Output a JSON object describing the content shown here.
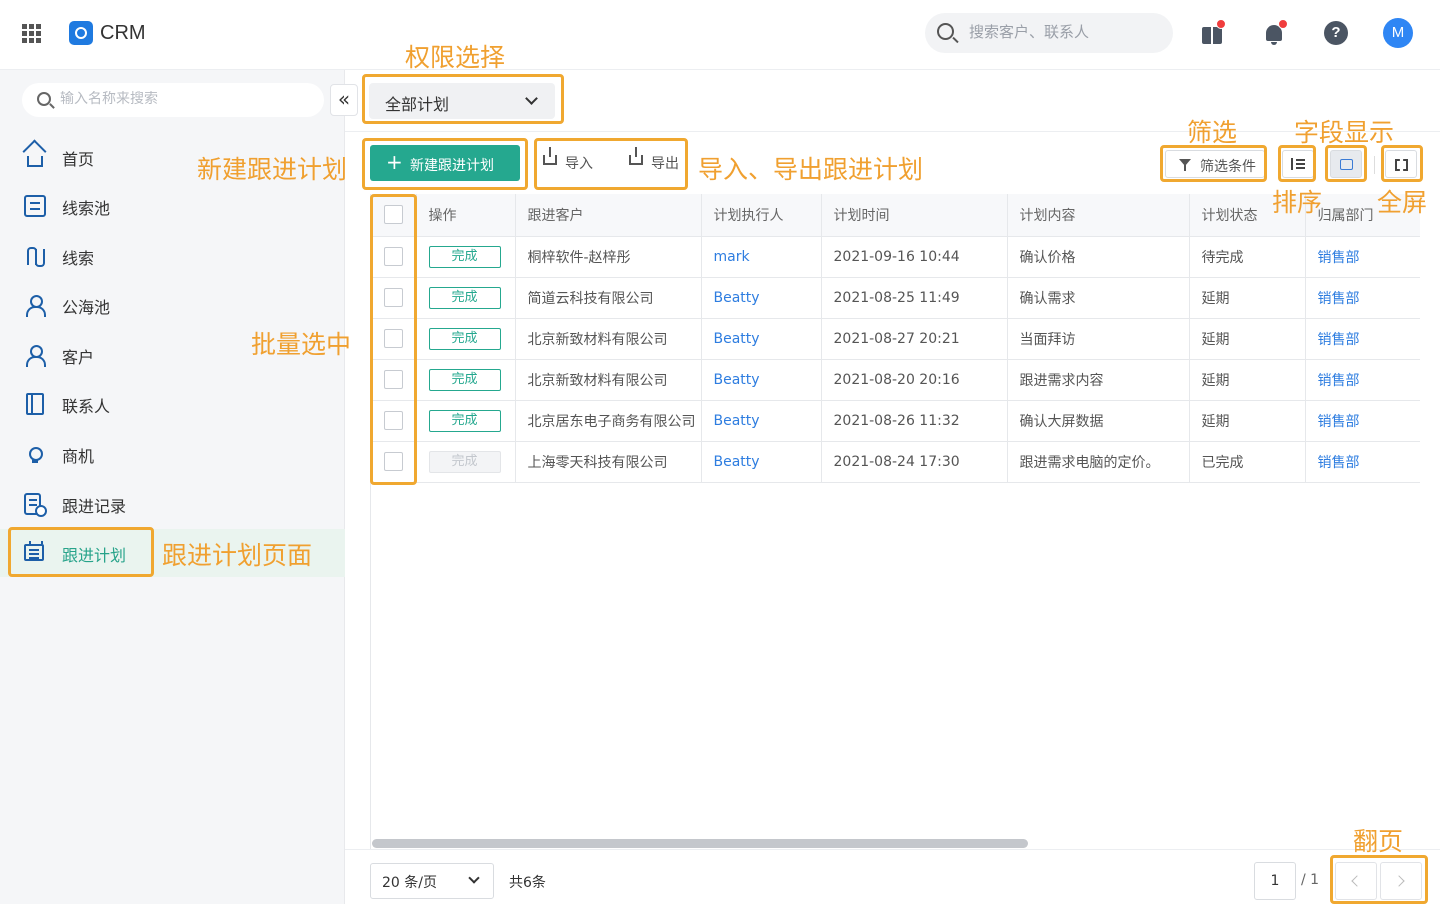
{
  "topbar": {
    "app_name": "CRM",
    "search_placeholder": "搜索客户、联系人",
    "avatar_letter": "M",
    "help_symbol": "?"
  },
  "sidebar": {
    "search_placeholder": "输入名称来搜索",
    "collapse_symbol": "«",
    "items": [
      {
        "label": "首页",
        "icon": "home-icon"
      },
      {
        "label": "线索池",
        "icon": "pool-icon"
      },
      {
        "label": "线索",
        "icon": "lead-icon"
      },
      {
        "label": "公海池",
        "icon": "public-pool-icon"
      },
      {
        "label": "客户",
        "icon": "customer-icon"
      },
      {
        "label": "联系人",
        "icon": "contacts-icon"
      },
      {
        "label": "商机",
        "icon": "opportunity-icon"
      },
      {
        "label": "跟进记录",
        "icon": "followup-record-icon"
      },
      {
        "label": "跟进计划",
        "icon": "followup-plan-icon",
        "active": true
      }
    ]
  },
  "toolbar": {
    "scope_value": "全部计划",
    "new_plan_label": "新建跟进计划",
    "import_label": "导入",
    "export_label": "导出",
    "filter_label": "筛选条件"
  },
  "table": {
    "columns": [
      "操作",
      "跟进客户",
      "计划执行人",
      "计划时间",
      "计划内容",
      "计划状态",
      "归属部门"
    ],
    "rows": [
      {
        "action": "完成",
        "action_disabled": false,
        "customer": "桐梓软件-赵梓彤",
        "executor": "mark",
        "time": "2021-09-16 10:44",
        "content": "确认价格",
        "status": "待完成",
        "dept": "销售部"
      },
      {
        "action": "完成",
        "action_disabled": false,
        "customer": "简道云科技有限公司",
        "executor": "Beatty",
        "time": "2021-08-25 11:49",
        "content": "确认需求",
        "status": "延期",
        "dept": "销售部"
      },
      {
        "action": "完成",
        "action_disabled": false,
        "customer": "北京新致材料有限公司",
        "executor": "Beatty",
        "time": "2021-08-27 20:21",
        "content": "当面拜访",
        "status": "延期",
        "dept": "销售部"
      },
      {
        "action": "完成",
        "action_disabled": false,
        "customer": "北京新致材料有限公司",
        "executor": "Beatty",
        "time": "2021-08-20 20:16",
        "content": "跟进需求内容",
        "status": "延期",
        "dept": "销售部"
      },
      {
        "action": "完成",
        "action_disabled": false,
        "customer": "北京居东电子商务有限公司",
        "executor": "Beatty",
        "time": "2021-08-26 11:32",
        "content": "确认大屏数据",
        "status": "延期",
        "dept": "销售部"
      },
      {
        "action": "完成",
        "action_disabled": true,
        "customer": "上海零天科技有限公司",
        "executor": "Beatty",
        "time": "2021-08-24 17:30",
        "content": "跟进需求电脑的定价。",
        "status": "已完成",
        "dept": "销售部"
      }
    ]
  },
  "pagination": {
    "page_size": "20 条/页",
    "total": "共6条",
    "current_page": "1",
    "total_pages": "/ 1"
  },
  "annotations": {
    "scope": "权限选择",
    "new_plan": "新建跟进计划",
    "import_export": "导入、导出跟进计划",
    "filter": "筛选",
    "field_display": "字段显示",
    "sort": "排序",
    "fullscreen": "全屏",
    "batch_select": "批量选中",
    "plan_page": "跟进计划页面",
    "paging": "翻页"
  },
  "colors": {
    "accent": "#25a88f",
    "link": "#2e7de0",
    "annotation": "#f0a830",
    "nav_icon": "#1d5fa8"
  }
}
